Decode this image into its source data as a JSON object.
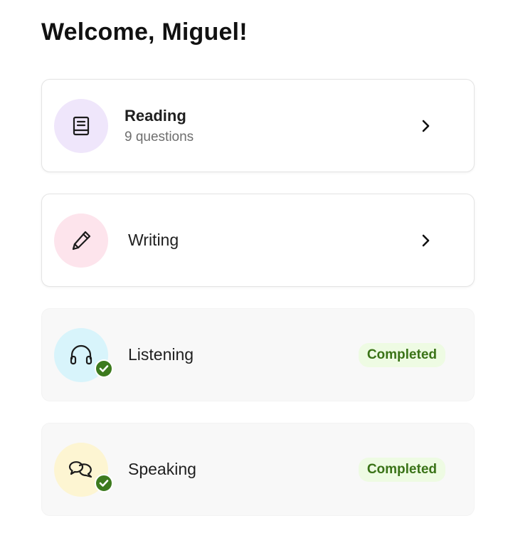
{
  "header": {
    "welcome": "Welcome, Miguel!"
  },
  "colors": {
    "reading_bg": "#efe6fb",
    "writing_bg": "#fde4ec",
    "listening_bg": "#d8f4fb",
    "speaking_bg": "#fdf5d2",
    "completed_green": "#3d7a1e",
    "badge_bg": "#eefbe3"
  },
  "sections": [
    {
      "title": "Reading",
      "subtitle": "9 questions",
      "icon": "book-icon",
      "status": "open"
    },
    {
      "title": "Writing",
      "icon": "pencil-icon",
      "status": "open"
    },
    {
      "title": "Listening",
      "icon": "headphones-icon",
      "status": "completed",
      "badge": "Completed"
    },
    {
      "title": "Speaking",
      "icon": "speech-bubbles-icon",
      "status": "completed",
      "badge": "Completed"
    }
  ]
}
